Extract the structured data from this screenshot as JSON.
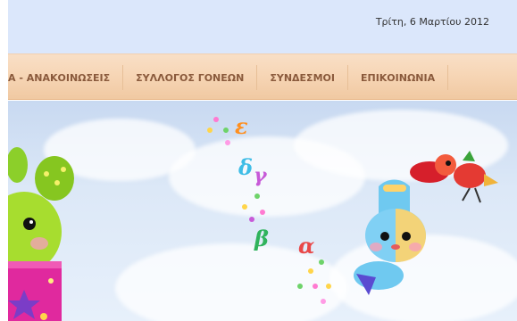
{
  "header": {
    "date_text": "Τρίτη, 6 Μαρτίου 2012"
  },
  "nav": {
    "items": [
      {
        "label": "Α - ΑΝΑΚΟΙΝΩΣΕΙΣ"
      },
      {
        "label": "ΣΥΛΛΟΓΟΣ ΓΟΝΕΩΝ"
      },
      {
        "label": "ΣΥΝΔΕΣΜΟΙ"
      },
      {
        "label": "ΕΠΙΚΟΙΝΩΝΙΑ"
      }
    ]
  },
  "banner": {
    "letters": {
      "epsilon": "ε",
      "delta": "δ",
      "gamma": "γ",
      "beta": "β",
      "alpha": "α"
    }
  },
  "colors": {
    "topbar_bg": "#dbe7fb",
    "nav_text": "#8a5a3c",
    "nav_bg": "#f7d6b6",
    "sky": "#dce8f7"
  }
}
